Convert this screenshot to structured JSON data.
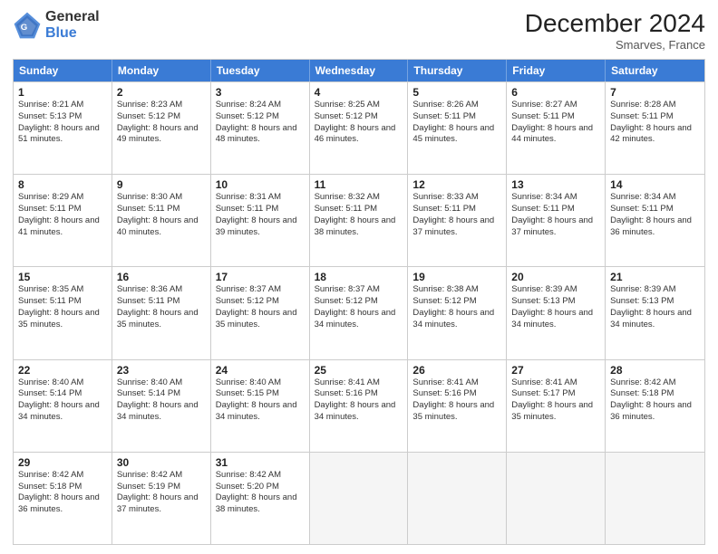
{
  "logo": {
    "general": "General",
    "blue": "Blue"
  },
  "header": {
    "month": "December 2024",
    "location": "Smarves, France"
  },
  "days": [
    "Sunday",
    "Monday",
    "Tuesday",
    "Wednesday",
    "Thursday",
    "Friday",
    "Saturday"
  ],
  "weeks": [
    [
      {
        "day": 1,
        "sunrise": "8:21 AM",
        "sunset": "5:13 PM",
        "daylight": "8 hours and 51 minutes."
      },
      {
        "day": 2,
        "sunrise": "8:23 AM",
        "sunset": "5:12 PM",
        "daylight": "8 hours and 49 minutes."
      },
      {
        "day": 3,
        "sunrise": "8:24 AM",
        "sunset": "5:12 PM",
        "daylight": "8 hours and 48 minutes."
      },
      {
        "day": 4,
        "sunrise": "8:25 AM",
        "sunset": "5:12 PM",
        "daylight": "8 hours and 46 minutes."
      },
      {
        "day": 5,
        "sunrise": "8:26 AM",
        "sunset": "5:11 PM",
        "daylight": "8 hours and 45 minutes."
      },
      {
        "day": 6,
        "sunrise": "8:27 AM",
        "sunset": "5:11 PM",
        "daylight": "8 hours and 44 minutes."
      },
      {
        "day": 7,
        "sunrise": "8:28 AM",
        "sunset": "5:11 PM",
        "daylight": "8 hours and 42 minutes."
      }
    ],
    [
      {
        "day": 8,
        "sunrise": "8:29 AM",
        "sunset": "5:11 PM",
        "daylight": "8 hours and 41 minutes."
      },
      {
        "day": 9,
        "sunrise": "8:30 AM",
        "sunset": "5:11 PM",
        "daylight": "8 hours and 40 minutes."
      },
      {
        "day": 10,
        "sunrise": "8:31 AM",
        "sunset": "5:11 PM",
        "daylight": "8 hours and 39 minutes."
      },
      {
        "day": 11,
        "sunrise": "8:32 AM",
        "sunset": "5:11 PM",
        "daylight": "8 hours and 38 minutes."
      },
      {
        "day": 12,
        "sunrise": "8:33 AM",
        "sunset": "5:11 PM",
        "daylight": "8 hours and 37 minutes."
      },
      {
        "day": 13,
        "sunrise": "8:34 AM",
        "sunset": "5:11 PM",
        "daylight": "8 hours and 37 minutes."
      },
      {
        "day": 14,
        "sunrise": "8:34 AM",
        "sunset": "5:11 PM",
        "daylight": "8 hours and 36 minutes."
      }
    ],
    [
      {
        "day": 15,
        "sunrise": "8:35 AM",
        "sunset": "5:11 PM",
        "daylight": "8 hours and 35 minutes."
      },
      {
        "day": 16,
        "sunrise": "8:36 AM",
        "sunset": "5:11 PM",
        "daylight": "8 hours and 35 minutes."
      },
      {
        "day": 17,
        "sunrise": "8:37 AM",
        "sunset": "5:12 PM",
        "daylight": "8 hours and 35 minutes."
      },
      {
        "day": 18,
        "sunrise": "8:37 AM",
        "sunset": "5:12 PM",
        "daylight": "8 hours and 34 minutes."
      },
      {
        "day": 19,
        "sunrise": "8:38 AM",
        "sunset": "5:12 PM",
        "daylight": "8 hours and 34 minutes."
      },
      {
        "day": 20,
        "sunrise": "8:39 AM",
        "sunset": "5:13 PM",
        "daylight": "8 hours and 34 minutes."
      },
      {
        "day": 21,
        "sunrise": "8:39 AM",
        "sunset": "5:13 PM",
        "daylight": "8 hours and 34 minutes."
      }
    ],
    [
      {
        "day": 22,
        "sunrise": "8:40 AM",
        "sunset": "5:14 PM",
        "daylight": "8 hours and 34 minutes."
      },
      {
        "day": 23,
        "sunrise": "8:40 AM",
        "sunset": "5:14 PM",
        "daylight": "8 hours and 34 minutes."
      },
      {
        "day": 24,
        "sunrise": "8:40 AM",
        "sunset": "5:15 PM",
        "daylight": "8 hours and 34 minutes."
      },
      {
        "day": 25,
        "sunrise": "8:41 AM",
        "sunset": "5:16 PM",
        "daylight": "8 hours and 34 minutes."
      },
      {
        "day": 26,
        "sunrise": "8:41 AM",
        "sunset": "5:16 PM",
        "daylight": "8 hours and 35 minutes."
      },
      {
        "day": 27,
        "sunrise": "8:41 AM",
        "sunset": "5:17 PM",
        "daylight": "8 hours and 35 minutes."
      },
      {
        "day": 28,
        "sunrise": "8:42 AM",
        "sunset": "5:18 PM",
        "daylight": "8 hours and 36 minutes."
      }
    ],
    [
      {
        "day": 29,
        "sunrise": "8:42 AM",
        "sunset": "5:18 PM",
        "daylight": "8 hours and 36 minutes."
      },
      {
        "day": 30,
        "sunrise": "8:42 AM",
        "sunset": "5:19 PM",
        "daylight": "8 hours and 37 minutes."
      },
      {
        "day": 31,
        "sunrise": "8:42 AM",
        "sunset": "5:20 PM",
        "daylight": "8 hours and 38 minutes."
      },
      null,
      null,
      null,
      null
    ]
  ]
}
